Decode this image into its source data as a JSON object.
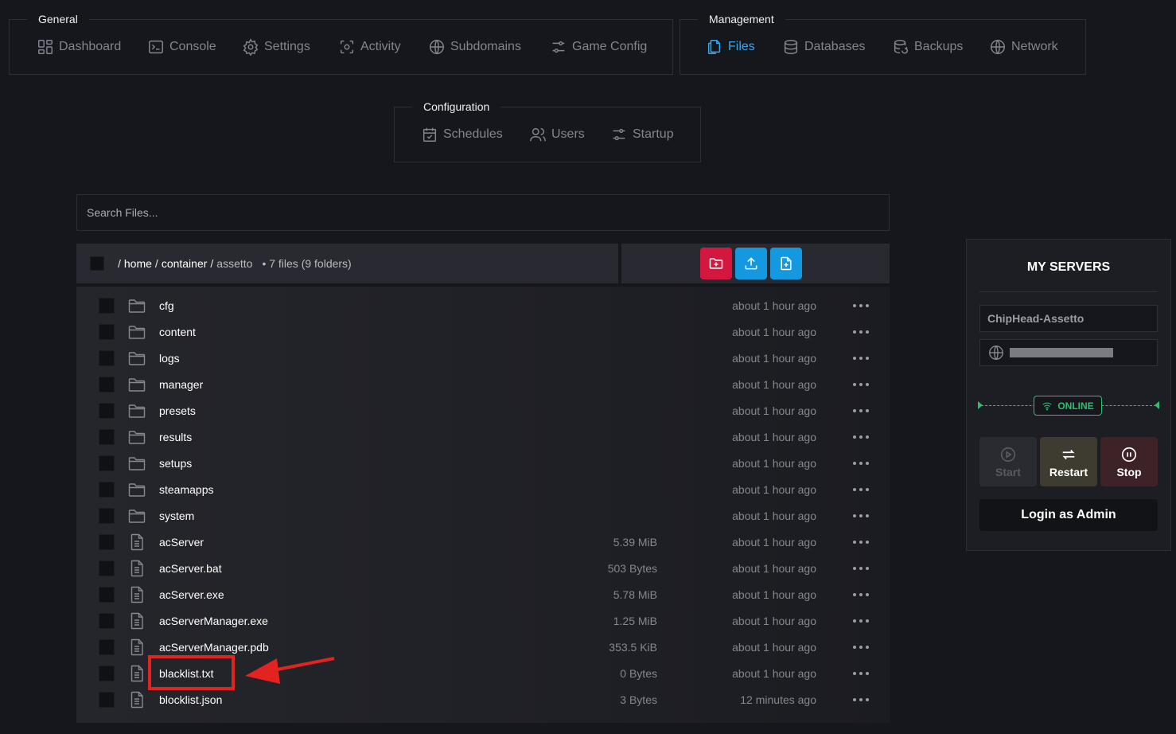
{
  "nav": {
    "general": {
      "title": "General",
      "items": [
        {
          "label": "Dashboard",
          "icon": "dashboard-icon"
        },
        {
          "label": "Console",
          "icon": "console-icon"
        },
        {
          "label": "Settings",
          "icon": "gear-icon"
        },
        {
          "label": "Activity",
          "icon": "activity-icon"
        },
        {
          "label": "Subdomains",
          "icon": "globe-icon"
        },
        {
          "label": "Game Config",
          "icon": "sliders-icon"
        }
      ]
    },
    "management": {
      "title": "Management",
      "items": [
        {
          "label": "Files",
          "icon": "files-icon",
          "active": true
        },
        {
          "label": "Databases",
          "icon": "database-icon"
        },
        {
          "label": "Backups",
          "icon": "backup-icon"
        },
        {
          "label": "Network",
          "icon": "globe-icon"
        }
      ]
    },
    "configuration": {
      "title": "Configuration",
      "items": [
        {
          "label": "Schedules",
          "icon": "calendar-icon"
        },
        {
          "label": "Users",
          "icon": "users-icon"
        },
        {
          "label": "Startup",
          "icon": "sliders-icon"
        }
      ]
    }
  },
  "search": {
    "placeholder": "Search Files..."
  },
  "breadcrumb": {
    "root_sep": "/",
    "segments": [
      "home",
      "container"
    ],
    "separators": [
      "/",
      "/"
    ],
    "current": "assetto",
    "count": "• 7 files (9 folders)"
  },
  "actions": {
    "new_folder_color": "#d3173e",
    "upload_color": "#1499e0",
    "new_file_color": "#1499e0"
  },
  "files": [
    {
      "name": "cfg",
      "type": "folder",
      "size": "",
      "modified": "about 1 hour ago"
    },
    {
      "name": "content",
      "type": "folder",
      "size": "",
      "modified": "about 1 hour ago"
    },
    {
      "name": "logs",
      "type": "folder",
      "size": "",
      "modified": "about 1 hour ago"
    },
    {
      "name": "manager",
      "type": "folder",
      "size": "",
      "modified": "about 1 hour ago"
    },
    {
      "name": "presets",
      "type": "folder",
      "size": "",
      "modified": "about 1 hour ago"
    },
    {
      "name": "results",
      "type": "folder",
      "size": "",
      "modified": "about 1 hour ago"
    },
    {
      "name": "setups",
      "type": "folder",
      "size": "",
      "modified": "about 1 hour ago"
    },
    {
      "name": "steamapps",
      "type": "folder",
      "size": "",
      "modified": "about 1 hour ago"
    },
    {
      "name": "system",
      "type": "folder",
      "size": "",
      "modified": "about 1 hour ago"
    },
    {
      "name": "acServer",
      "type": "file",
      "size": "5.39 MiB",
      "modified": "about 1 hour ago"
    },
    {
      "name": "acServer.bat",
      "type": "file",
      "size": "503 Bytes",
      "modified": "about 1 hour ago"
    },
    {
      "name": "acServer.exe",
      "type": "file",
      "size": "5.78 MiB",
      "modified": "about 1 hour ago"
    },
    {
      "name": "acServerManager.exe",
      "type": "file",
      "size": "1.25 MiB",
      "modified": "about 1 hour ago"
    },
    {
      "name": "acServerManager.pdb",
      "type": "file",
      "size": "353.5 KiB",
      "modified": "about 1 hour ago"
    },
    {
      "name": "blacklist.txt",
      "type": "file",
      "size": "0 Bytes",
      "modified": "about 1 hour ago",
      "highlighted": true
    },
    {
      "name": "blocklist.json",
      "type": "file",
      "size": "3 Bytes",
      "modified": "12 minutes ago"
    }
  ],
  "annotation": {
    "highlight_color": "#e3231f"
  },
  "servers": {
    "title": "MY SERVERS",
    "name": "ChipHead-Assetto",
    "status": "ONLINE",
    "status_color": "#2bc06a",
    "buttons": {
      "start": "Start",
      "restart": "Restart",
      "stop": "Stop"
    },
    "login": "Login as Admin"
  }
}
